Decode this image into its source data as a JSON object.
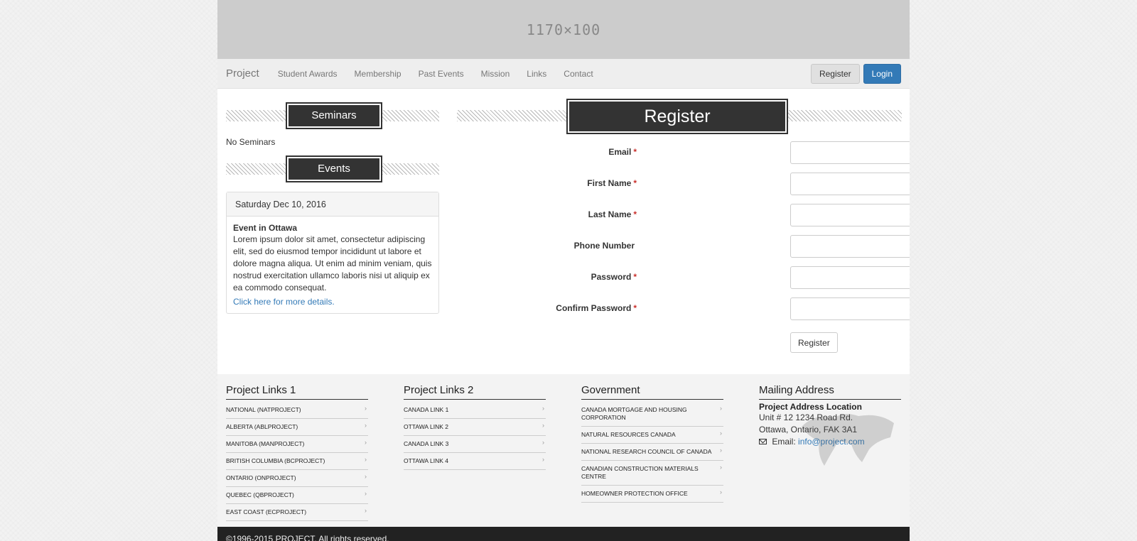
{
  "banner": {
    "text": "1170×100"
  },
  "nav": {
    "brand": "Project",
    "links": [
      "Student Awards",
      "Membership",
      "Past Events",
      "Mission",
      "Links",
      "Contact"
    ],
    "register_label": "Register",
    "login_label": "Login"
  },
  "sidebar": {
    "seminars_heading": "Seminars",
    "seminars_empty": "No Seminars",
    "events_heading": "Events",
    "event": {
      "date": "Saturday Dec 10, 2016",
      "title": "Event in Ottawa",
      "text": "Lorem ipsum dolor sit amet, consectetur adipiscing elit, sed do eiusmod tempor incididunt ut labore et dolore magna aliqua. Ut enim ad minim veniam, quis nostrud exercitation ullamco laboris nisi ut aliquip ex ea commodo consequat.",
      "link": "Click here for more details."
    }
  },
  "register_form": {
    "heading": "Register",
    "fields": [
      {
        "label": "Email",
        "required": "*"
      },
      {
        "label": "First Name",
        "required": "*"
      },
      {
        "label": "Last Name",
        "required": "*"
      },
      {
        "label": "Phone Number",
        "required": ""
      },
      {
        "label": "Password",
        "required": "*"
      },
      {
        "label": "Confirm Password",
        "required": "*"
      }
    ],
    "submit_label": "Register"
  },
  "footer": {
    "col1": {
      "title": "Project Links 1",
      "items": [
        "National (NATPROJECT)",
        "Alberta (ABLPROJECT)",
        "Manitoba (MANPROJECT)",
        "British Columbia (BCPROJECT)",
        "Ontario (ONPROJECT)",
        "Quebec (QBPROJECT)",
        "East Coast (ECPROJECT)"
      ]
    },
    "col2": {
      "title": "Project Links 2",
      "items": [
        "Canada Link 1",
        "Ottawa Link 2",
        "Canada Link 3",
        "Ottawa Link 4"
      ]
    },
    "col3": {
      "title": "Government",
      "items": [
        "Canada Mortgage and Housing Corporation",
        "Natural Resources Canada",
        "National Research Council of Canada",
        "Canadian Construction Materials Centre",
        "Homeowner Protection Office"
      ]
    },
    "col4": {
      "title": "Mailing Address",
      "address_title": "Project Address Location",
      "line1": "Unit # 12 1234 Road Rd.",
      "line2": "Ottawa, Ontario, FAK 3A1",
      "email_label": "Email:",
      "email": "info@project.com"
    },
    "copyright": "©1996-2015 PROJECT. All rights reserved."
  },
  "chevron_glyph": "›"
}
